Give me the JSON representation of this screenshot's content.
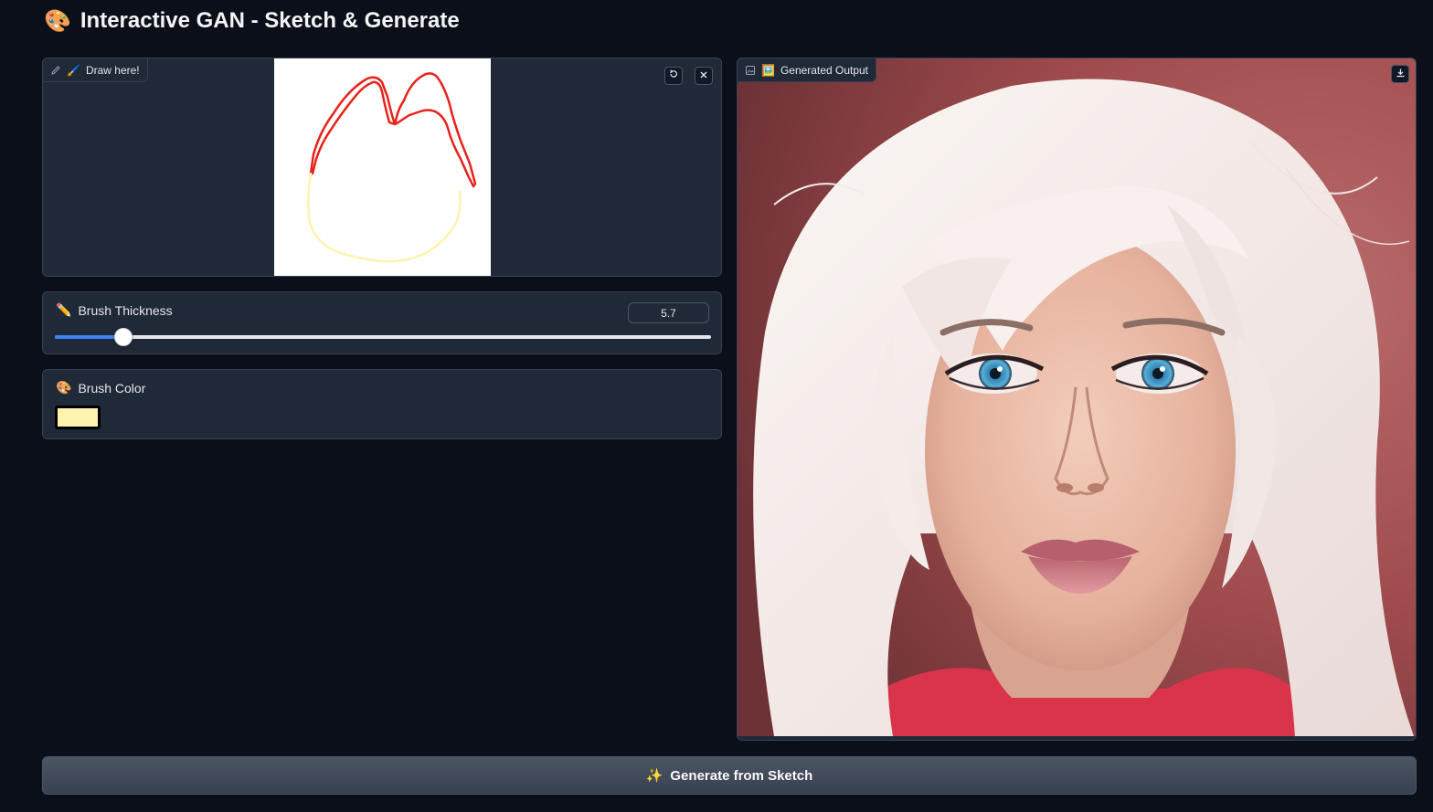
{
  "app": {
    "title": "Interactive GAN - Sketch & Generate",
    "title_emoji": "🎨"
  },
  "sketch": {
    "label": "Draw here!",
    "label_emoji": "🖌️",
    "icons": [
      "pencil-icon",
      "undo-icon",
      "close-icon"
    ],
    "stroke_colors": {
      "hair": "#e8211a",
      "face": "#fff3b0"
    }
  },
  "thickness": {
    "label": "Brush Thickness",
    "label_emoji": "✏️",
    "value": "5.7",
    "fraction": 0.105
  },
  "color": {
    "label": "Brush Color",
    "label_emoji": "🎨",
    "value": "#fff3b0"
  },
  "output": {
    "label": "Generated Output",
    "label_emoji": "🖼️",
    "icons": [
      "image-icon",
      "download-icon"
    ]
  },
  "generate": {
    "label": "Generate from Sketch",
    "emoji": "✨"
  },
  "colors": {
    "background": "#0b0f19",
    "panel": "#1f2937",
    "accent": "#3b82f6"
  }
}
